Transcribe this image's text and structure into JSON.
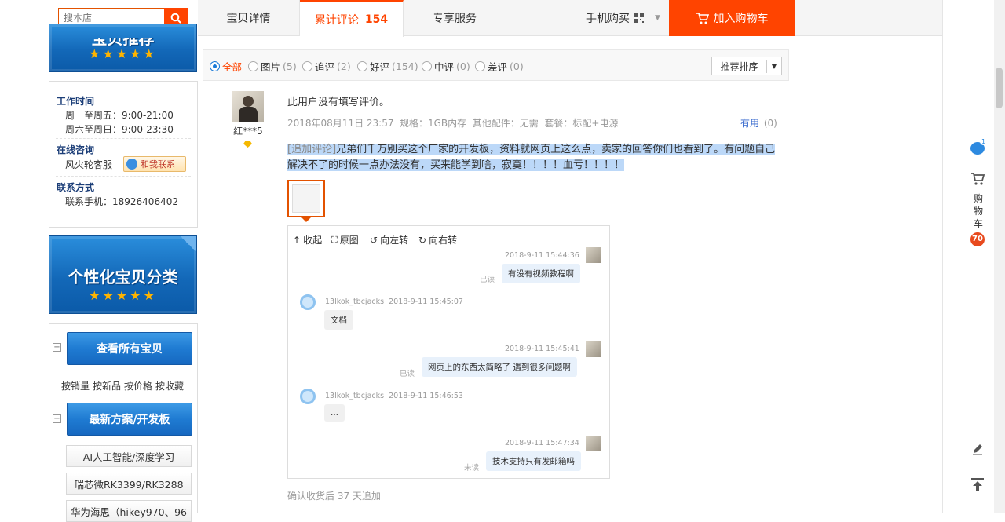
{
  "search": {
    "placeholder": "搜本店"
  },
  "banner1": {
    "title": "宝贝推荐",
    "stars": "★★★★★"
  },
  "banner2": {
    "title": "个性化宝贝分类",
    "stars": "★★★★★"
  },
  "service": {
    "work_time_title": "工作时间",
    "weekday": "周一至周五：9:00-21:00",
    "weekend": "周六至周日：9:00-23:30",
    "consult_title": "在线咨询",
    "agent": "风火轮客服",
    "contact_btn": "和我联系",
    "contact_title": "联系方式",
    "phone": "联系手机：18926406402"
  },
  "categories": {
    "view_all": "查看所有宝贝",
    "sort_links": [
      "按销量",
      "按新品",
      "按价格",
      "按收藏"
    ],
    "latest": "最新方案/开发板",
    "items": [
      "AI人工智能/深度学习",
      "瑞芯微RK3399/RK3288",
      "华为海思（hikey970、96"
    ]
  },
  "tabs": {
    "detail": "宝贝详情",
    "reviews_label": "累计评论",
    "reviews_count": "154",
    "service": "专享服务",
    "mobile": "手机购买",
    "add_cart": "加入购物车"
  },
  "filters": {
    "all": "全部",
    "items": [
      {
        "label": "图片",
        "count": "(5)"
      },
      {
        "label": "追评",
        "count": "(2)"
      },
      {
        "label": "好评",
        "count": "(154)"
      },
      {
        "label": "中评",
        "count": "(0)"
      },
      {
        "label": "差评",
        "count": "(0)"
      }
    ],
    "sort": "推荐排序"
  },
  "review": {
    "user": "红***5",
    "text": "此用户没有填写评价。",
    "date": "2018年08月11日 23:57",
    "spec": "规格：1GB内存  其他配件：无需  套餐：标配+电源",
    "useful": "有用",
    "useful_count": "(0)",
    "append_tag": "[追加评论]",
    "append_text": "兄弟们千万别买这个厂家的开发板，资料就网页上这么点，卖家的回答你们也看到了。有问题自己解决不了的时候一点办法没有，买来能学到啥，寂寞！！！！血亏！！！！",
    "footer": "确认收货后 37 天追加"
  },
  "viewer": {
    "collapse": "收起",
    "original": "原图",
    "rotate_left": "向左转",
    "rotate_right": "向右转",
    "messages": [
      {
        "side": "right",
        "time": "2018-9-11 15:44:36",
        "text": "有没有视频教程啊",
        "status": "已读"
      },
      {
        "side": "left",
        "name": "13lkok_tbcjacks",
        "time": "2018-9-11 15:45:07",
        "text": "文档"
      },
      {
        "side": "right",
        "time": "2018-9-11 15:45:41",
        "text": "网页上的东西太简略了  遇到很多问题啊",
        "status": "已读"
      },
      {
        "side": "left",
        "name": "13lkok_tbcjacks",
        "time": "2018-9-11 15:46:53",
        "text": "..."
      },
      {
        "side": "right",
        "time": "2018-9-11 15:47:34",
        "text": "技术支持只有发邮箱吗",
        "status": "未读"
      }
    ]
  },
  "rail": {
    "cart_label": "购物车",
    "cart_count": "70",
    "msg_count": "1"
  },
  "colors": {
    "accent": "#ff4400",
    "blue": "#1a7ad7"
  }
}
